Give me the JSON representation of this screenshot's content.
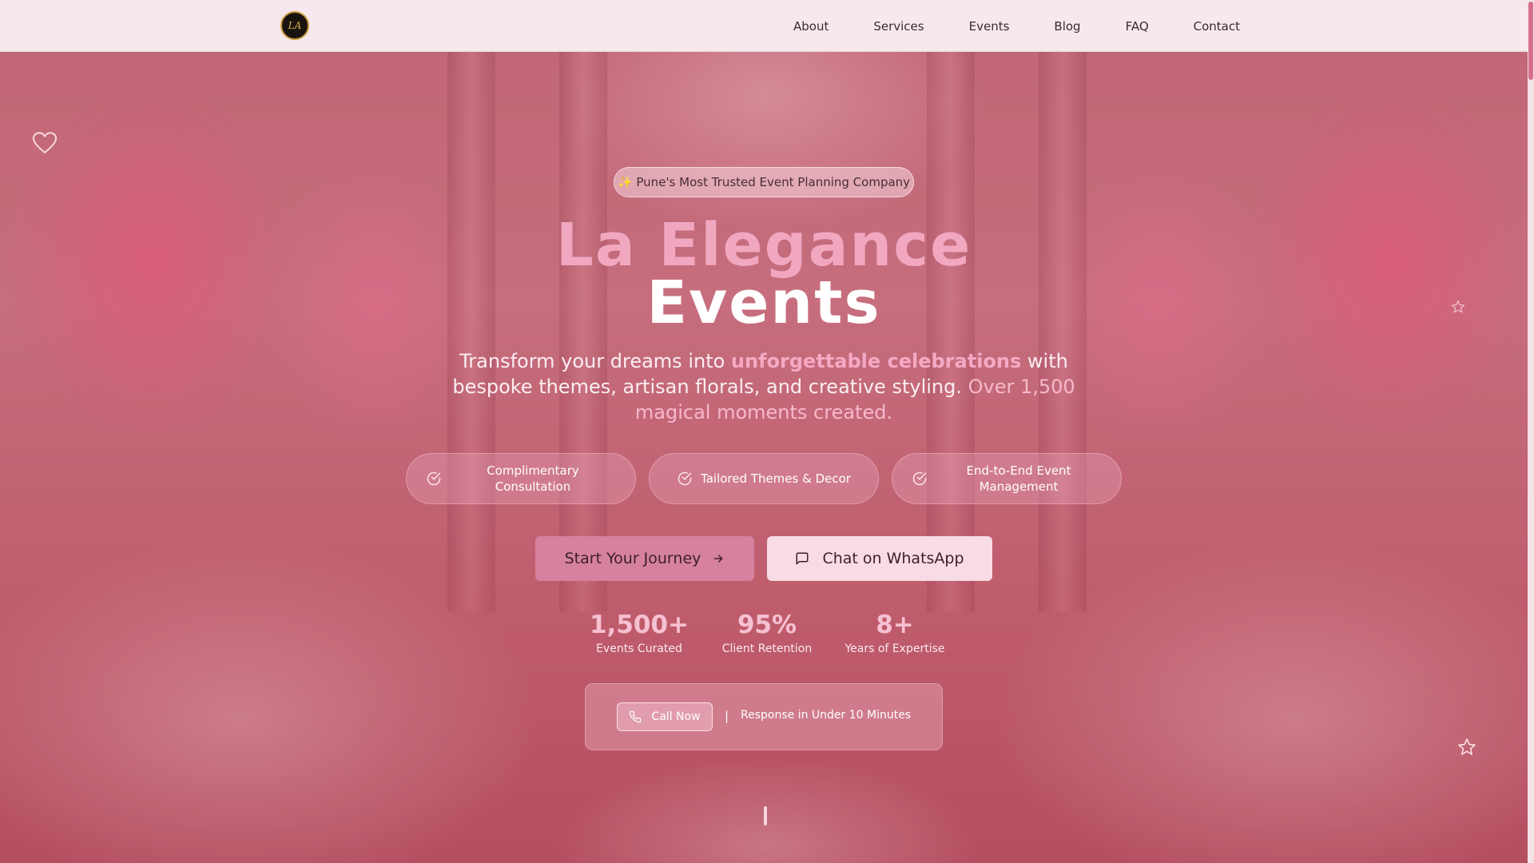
{
  "nav": {
    "logo_text": "LA",
    "links": [
      "About",
      "Services",
      "Events",
      "Blog",
      "FAQ",
      "Contact"
    ]
  },
  "hero": {
    "badge": "✨ Pune's Most Trusted Event Planning Company",
    "title_line1": "La Elegance",
    "title_line2": "Events",
    "subtitle_part1": "Transform your dreams into ",
    "subtitle_highlight": "unforgettable celebrations",
    "subtitle_part2": " with bespoke themes, artisan florals, and creative styling. ",
    "subtitle_soft": "Over 1,500 magical moments created.",
    "features": [
      {
        "label": "Complimentary Consultation",
        "icon": "check-circle-icon"
      },
      {
        "label": "Tailored Themes & Decor",
        "icon": "check-circle-icon"
      },
      {
        "label": "End-to-End Event Management",
        "icon": "check-circle-icon"
      }
    ],
    "primary_button": "Start Your Journey",
    "secondary_button": "Chat on WhatsApp",
    "stats": [
      {
        "value": "1,500+",
        "label": "Events Curated"
      },
      {
        "value": "95%",
        "label": "Client Retention"
      },
      {
        "value": "8+",
        "label": "Years of Expertise"
      }
    ],
    "call": {
      "button": "Call Now",
      "separator": "|",
      "text": "Response in Under 10 Minutes"
    }
  },
  "colors": {
    "accent_pink": "#f2a7c0",
    "button_primary": "#d5819f",
    "button_secondary": "#f7dbe5",
    "nav_bg": "#f6e9ed"
  }
}
